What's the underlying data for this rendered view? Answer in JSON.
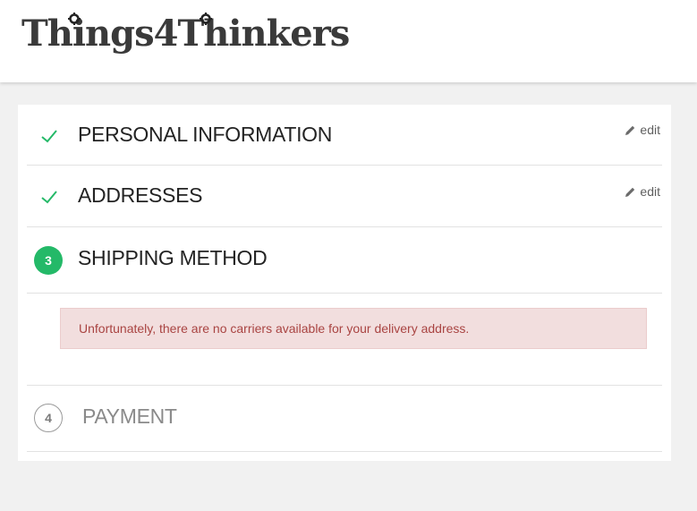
{
  "brand": {
    "name": "Things4Thinkers"
  },
  "steps": [
    {
      "label": "PERSONAL INFORMATION",
      "status": "complete",
      "edit": "edit"
    },
    {
      "label": "ADDRESSES",
      "status": "complete",
      "edit": "edit"
    },
    {
      "number": "3",
      "label": "SHIPPING METHOD",
      "status": "current"
    },
    {
      "number": "4",
      "label": "PAYMENT",
      "status": "upcoming"
    }
  ],
  "alert": {
    "message": "Unfortunately, there are no carriers available for your delivery address."
  },
  "colors": {
    "accent": "#24b968",
    "alert_bg": "#f2dede",
    "alert_text": "#a94442",
    "check": "#24b968"
  }
}
